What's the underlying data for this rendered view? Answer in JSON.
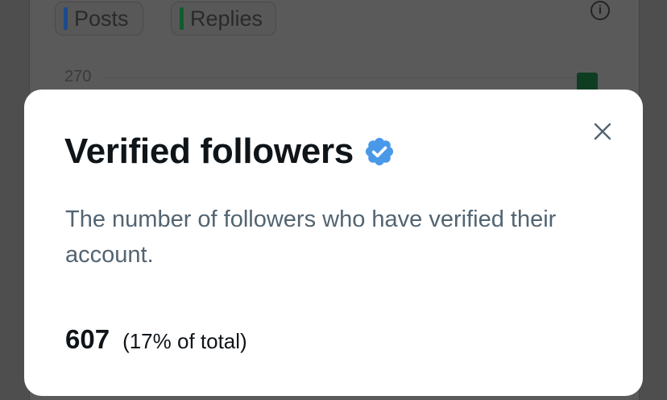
{
  "background": {
    "legend": [
      {
        "label": "Posts",
        "color": "#1d4a8c"
      },
      {
        "label": "Replies",
        "color": "#0f5c2e"
      }
    ],
    "info_icon": "info-icon",
    "axis_tick": "270",
    "bar_color": "#0f3d22"
  },
  "modal": {
    "title": "Verified followers",
    "verified_icon": "verified-badge-icon",
    "badge_color": "#4a99e9",
    "description": "The number of followers who have verified their account.",
    "stat_value": "607",
    "stat_percent": "(17% of total)",
    "close_icon": "close-icon"
  }
}
